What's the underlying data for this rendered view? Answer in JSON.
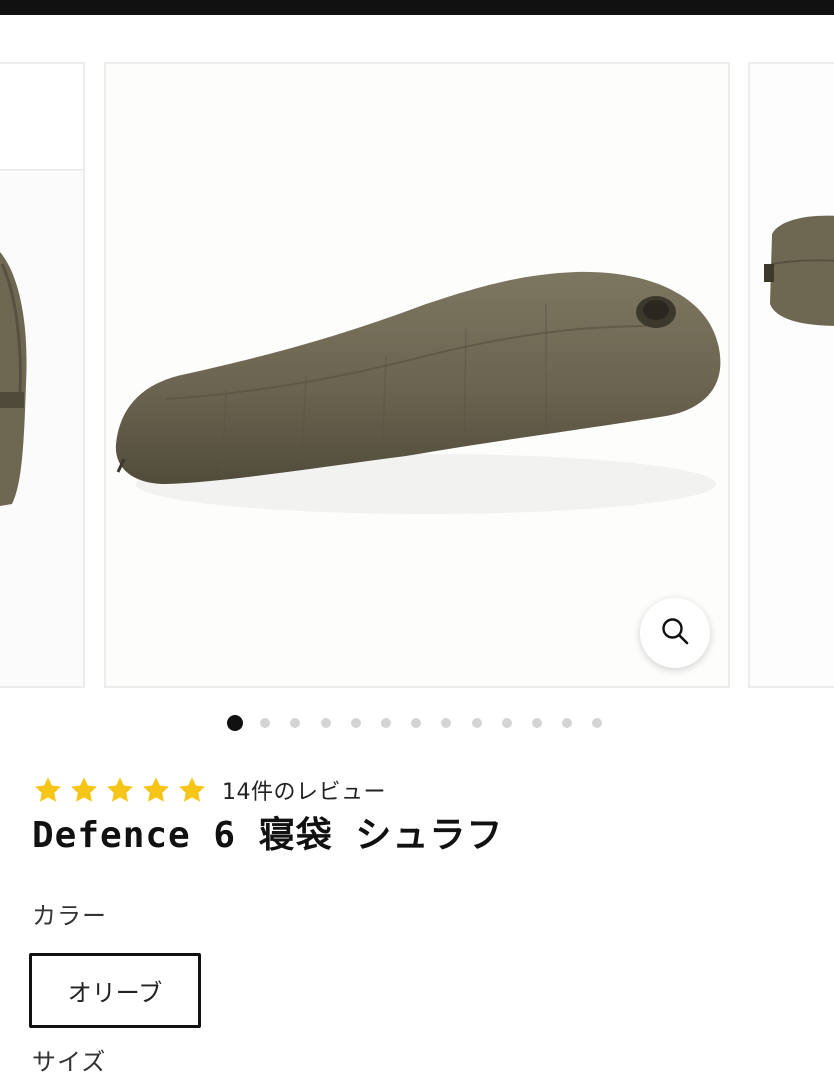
{
  "product": {
    "review_count_text": "14件のレビュー",
    "rating_stars": 5,
    "title": "Defence 6 寝袋 シュラフ"
  },
  "gallery": {
    "total_slides": 13,
    "active_index": 0,
    "zoom_icon": "magnifier-icon"
  },
  "options": {
    "color_label": "カラー",
    "color_selected": "オリーブ",
    "size_label": "サイズ"
  },
  "colors": {
    "star": "#F5C518",
    "olive": "#6B6450",
    "dot_active": "#111111",
    "dot_inactive": "#d4d4d4"
  }
}
